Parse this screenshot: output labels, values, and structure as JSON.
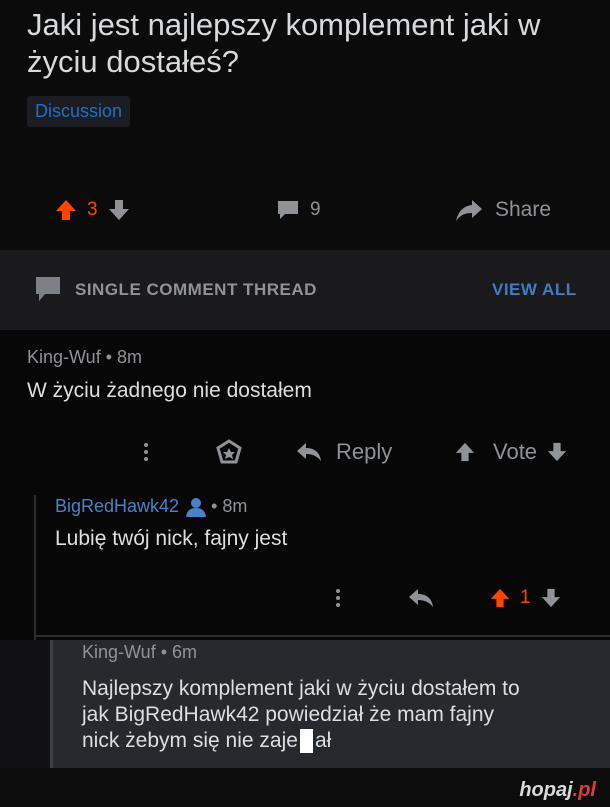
{
  "post": {
    "title": "Jaki jest najlepszy komplement jaki w życiu dostałeś?",
    "flair": "Discussion",
    "score": "3",
    "comment_count": "9",
    "share_label": "Share"
  },
  "thread_bar": {
    "label": "SINGLE COMMENT THREAD",
    "view_all": "VIEW ALL"
  },
  "comments": [
    {
      "meta": "King-Wuf • 8m",
      "body": "W życiu żadnego nie dostałem",
      "reply_label": "Reply",
      "vote_label": "Vote"
    },
    {
      "author": "BigRedHawk42",
      "time": "• 8m",
      "body": "Lubię twój nick, fajny jest",
      "score": "1"
    },
    {
      "meta": "King-Wuf • 6m",
      "body_line1": "Najlepszy komplement jaki w życiu dostałem to",
      "body_line2": "jak BigRedHawk42 powiedział że mam fajny",
      "body_line3_a": "nick żebym się nie zaje",
      "body_line3_b": "ał"
    }
  ],
  "watermark": {
    "main": "hopaj",
    "suffix": ".pl"
  },
  "colors": {
    "upvote": "#ff4500",
    "link_blue": "#3f7cc4",
    "user_blue": "#4a82c7"
  }
}
